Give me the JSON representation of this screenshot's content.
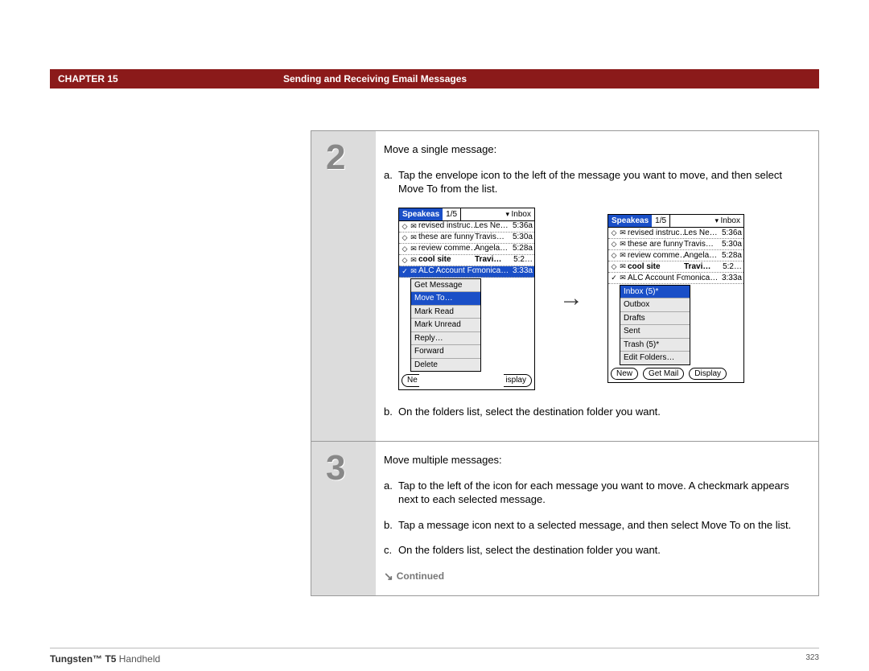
{
  "header": {
    "chapter": "CHAPTER 15",
    "title": "Sending and Receiving Email Messages"
  },
  "steps": [
    {
      "num": "2",
      "intro": "Move a single message:",
      "subs": [
        {
          "lbl": "a.",
          "txt": "Tap the envelope icon to the left of the message you want to move, and then select Move To from the list."
        },
        {
          "lbl": "b.",
          "txt": "On the folders list, select the destination folder you want."
        }
      ],
      "screenshots": true
    },
    {
      "num": "3",
      "intro": "Move multiple messages:",
      "subs": [
        {
          "lbl": "a.",
          "txt": "Tap to the left of the icon for each message you want to move. A checkmark appears next to each selected message."
        },
        {
          "lbl": "b.",
          "txt": "Tap a message icon next to a selected message, and then select Move To on the list."
        },
        {
          "lbl": "c.",
          "txt": "On the folders list, select the destination folder you want."
        }
      ],
      "continued": true
    }
  ],
  "continued_label": "Continued",
  "palm": {
    "account": "Speakeas",
    "count": "1/5",
    "folder": "Inbox",
    "messages": [
      {
        "mark": "◇",
        "env": "✉",
        "subj": "revised instruc…",
        "from": "Les Ne…",
        "time": "5:36a",
        "bold": false
      },
      {
        "mark": "◇",
        "env": "✉",
        "subj": "these are funny",
        "from": "Travis…",
        "time": "5:30a",
        "bold": false
      },
      {
        "mark": "◇",
        "env": "✉",
        "subj": "review comme…",
        "from": "Angela…",
        "time": "5:28a",
        "bold": false
      },
      {
        "mark": "◇",
        "env": "✉",
        "subj": "cool site",
        "from": "Travi…",
        "time": "5:2…",
        "bold": true
      },
      {
        "mark": "✓",
        "env": "✉",
        "subj": "ALC Account Fo…",
        "from": "monica…",
        "time": "3:33a",
        "bold": false,
        "sel": true
      }
    ],
    "context_menu": [
      "Get Message",
      "Move To…",
      "Mark Read",
      "Mark Unread",
      "Reply…",
      "Forward",
      "Delete"
    ],
    "context_menu_highlight": 1,
    "folder_menu": [
      "Inbox (5)*",
      "Outbox",
      "Drafts",
      "Sent",
      "Trash (5)*",
      "Edit Folders…"
    ],
    "folder_menu_highlight": 0,
    "buttons_left": {
      "a": "Ne",
      "c": "isplay"
    },
    "buttons_right": [
      "New",
      "Get Mail",
      "Display"
    ]
  },
  "footer": {
    "product_bold": "Tungsten™ T5",
    "product_rest": " Handheld",
    "page": "323"
  }
}
